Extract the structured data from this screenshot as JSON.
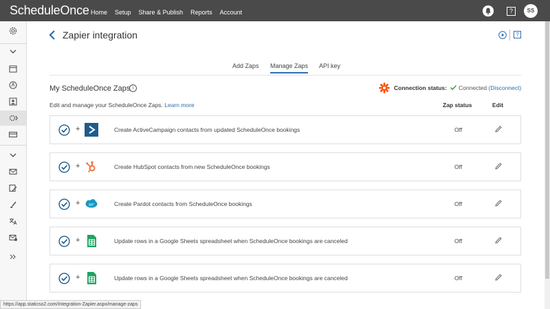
{
  "topbar": {
    "logo": "ScheduleOnce",
    "nav": [
      "Home",
      "Setup",
      "Share & Publish",
      "Reports",
      "Account"
    ],
    "help": "?",
    "avatar_initials": "SS"
  },
  "header": {
    "title": "Zapier integration",
    "help": "?"
  },
  "tabs": [
    "Add Zaps",
    "Manage Zaps",
    "API key"
  ],
  "active_tab": "Manage Zaps",
  "section": {
    "title": "My ScheduleOnce Zaps",
    "info": "i",
    "connection_label": "Connection status:",
    "connection_value": "Connected",
    "disconnect": "(Disconnect)",
    "description": "Edit and manage your ScheduleOnce Zaps.",
    "learn_more": "Learn more",
    "col_status": "Zap status",
    "col_edit": "Edit"
  },
  "zaps": [
    {
      "app": "activecampaign-icon",
      "text": "Create ActiveCampaign contacts from updated ScheduleOnce bookings",
      "status": "Off"
    },
    {
      "app": "hubspot-icon",
      "text": "Create HubSpot contacts from new ScheduleOnce bookings",
      "status": "Off"
    },
    {
      "app": "salesforce-pardot-icon",
      "text": "Create Pardot contacts from ScheduleOnce bookings",
      "status": "Off"
    },
    {
      "app": "google-sheets-icon",
      "text": "Update rows in a Google Sheets spreadsheet when ScheduleOnce bookings are canceled",
      "status": "Off"
    },
    {
      "app": "google-sheets-icon",
      "text": "Update rows in a Google Sheets spreadsheet when ScheduleOnce bookings are canceled",
      "status": "Off"
    }
  ],
  "statusbar": "https://app.staticso2.com/Integration-Zapier.aspx/manage-zaps",
  "colors": {
    "topbar": "#4a4a4a",
    "accent": "#2a6fb3",
    "zapier": "#ff4a00",
    "check": "#3aa64a"
  }
}
